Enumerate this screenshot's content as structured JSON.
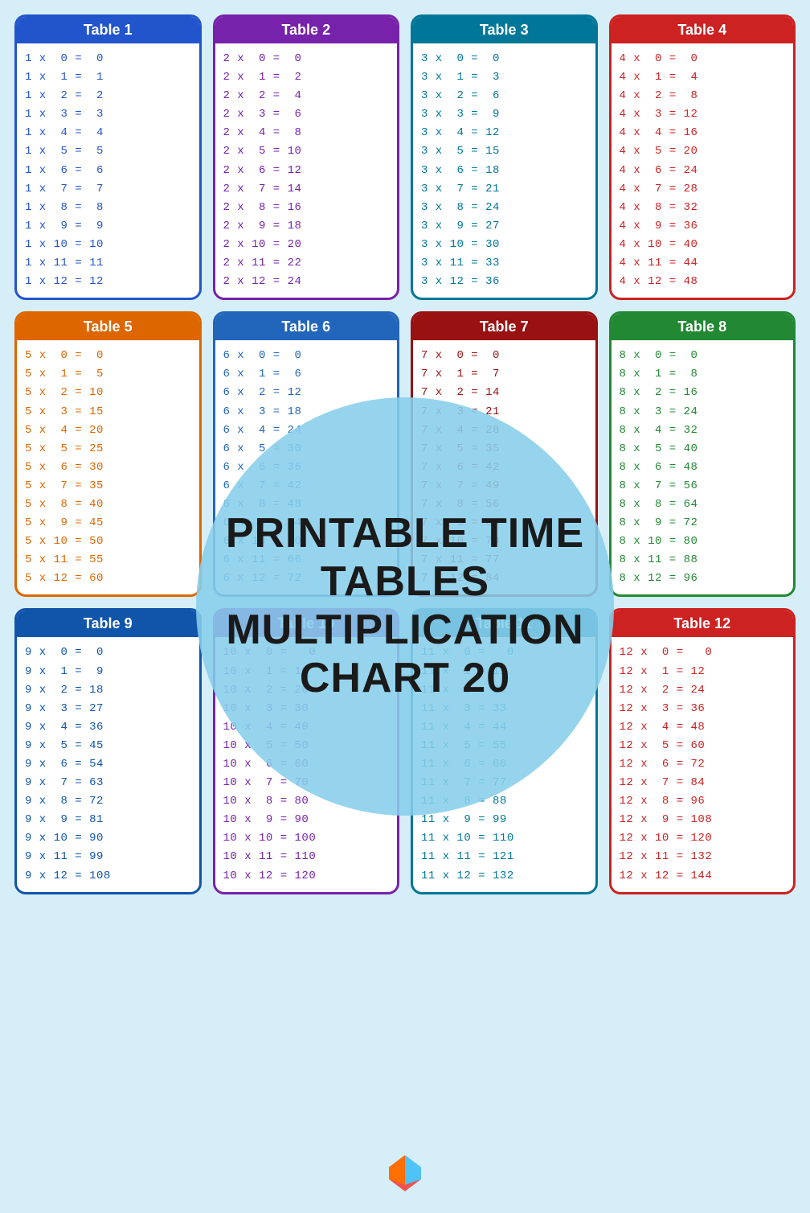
{
  "title": "PRINTABLE TIME TABLES MULTIPLICATION CHART 20",
  "background_color": "#d6eef8",
  "circle_color": "rgba(135,206,235,0.88)",
  "tables": [
    {
      "id": 1,
      "label": "Table 1",
      "color": "blue",
      "rows": [
        "1 x  0  =  0",
        "1 x  1  =  1",
        "1 x  2  =  2",
        "1 x  3  =  3",
        "1 x  4  =  4",
        "1 x  5  =  5",
        "1 x  6  =  6",
        "1 x  7  =  7",
        "1 x  8  =  8",
        "1 x  9  =  9",
        "1 x 10  = 10",
        "1 x 11  = 11",
        "1 x 12  = 12"
      ]
    },
    {
      "id": 2,
      "label": "Table 2",
      "color": "purple",
      "rows": [
        "2 x  0  =  0",
        "2 x  1  =  2",
        "2 x  2  =  4",
        "2 x  3  =  6",
        "2 x  4  =  8",
        "2 x  5  = 10",
        "2 x  6  = 12",
        "2 x  7  = 14",
        "2 x  8  = 16",
        "2 x  9  = 18",
        "2 x 10  = 20",
        "2 x 11  = 22",
        "2 x 12  = 24"
      ]
    },
    {
      "id": 3,
      "label": "Table 3",
      "color": "teal",
      "rows": [
        "3 x  0  =  0",
        "3 x  1  =  3",
        "3 x  2  =  6",
        "3 x  3  =  9",
        "3 x  4  = 12",
        "3 x  5  = 15",
        "3 x  6  = 18",
        "3 x  7  = 21",
        "3 x  8  = 24",
        "3 x  9  = 27",
        "3 x 10  = 30",
        "3 x 11  = 33",
        "3 x 12  = 36"
      ]
    },
    {
      "id": 4,
      "label": "Table 4",
      "color": "red",
      "rows": [
        "4 x  0  =  0",
        "4 x  1  =  4",
        "4 x  2  =  8",
        "4 x  3  = 12",
        "4 x  4  = 16",
        "4 x  5  = 20",
        "4 x  6  = 24",
        "4 x  7  = 28",
        "4 x  8  = 32",
        "4 x  9  = 36",
        "4 x 10  = 40",
        "4 x 11  = 44",
        "4 x 12  = 48"
      ]
    },
    {
      "id": 5,
      "label": "Table 5",
      "color": "orange",
      "rows": [
        "5 x  0  =  0",
        "5 x  1  =  5",
        "5 x  2  = 10",
        "5 x  3  = 15",
        "5 x  4  = 20",
        "5 x  5  = 25",
        "5 x  6  = 30",
        "5 x  7  = 35",
        "5 x  8  = 40",
        "5 x  9  = 45",
        "5 x 10  = 50",
        "5 x 11  = 55",
        "5 x 12  = 60"
      ]
    },
    {
      "id": 6,
      "label": "Table 6",
      "color": "blue2",
      "rows": [
        "6 x  0  =  0",
        "6 x  1  =  6",
        "6 x  2  = 12",
        "6 x  3  = 18",
        "6 x  4  = 24",
        "6 x  5  = 30",
        "6 x  6  = 36",
        "6 x  7  = 42",
        "6 x  8  = 48",
        "6 x  9  = 54",
        "6 x 10  = 60",
        "6 x 11  = 66",
        "6 x 12  = 72"
      ]
    },
    {
      "id": 7,
      "label": "Table 7",
      "color": "darkred",
      "rows": [
        "7 x  0  =  0",
        "7 x  1  =  7",
        "7 x  2  = 14",
        "7 x  3  = 21",
        "7 x  4  = 28",
        "7 x  5  = 35",
        "7 x  6  = 42",
        "7 x  7  = 49",
        "7 x  8  = 56",
        "7 x  9  = 63",
        "7 x 10  = 70",
        "7 x 11  = 77",
        "7 x 12  = 84"
      ]
    },
    {
      "id": 8,
      "label": "Table 8",
      "color": "green",
      "rows": [
        "8 x  0  =  0",
        "8 x  1  =  8",
        "8 x  2  = 16",
        "8 x  3  = 24",
        "8 x  4  = 32",
        "8 x  5  = 40",
        "8 x  6  = 48",
        "8 x  7  = 56",
        "8 x  8  = 64",
        "8 x  9  = 72",
        "8 x 10  = 80",
        "8 x 11  = 88",
        "8 x 12  = 96"
      ]
    },
    {
      "id": 9,
      "label": "Table 9",
      "color": "darkblue",
      "rows": [
        "9 x  0  =  0",
        "9 x  1  =  9",
        "9 x  2  = 18",
        "9 x  3  = 27",
        "9 x  4  = 36",
        "9 x  5  = 45",
        "9 x  6  = 54",
        "9 x  7  = 63",
        "9 x  8  = 72",
        "9 x  9  = 81",
        "9 x 10  = 90",
        "9 x 11  = 99",
        "9 x 12  = 108"
      ]
    },
    {
      "id": 10,
      "label": "Table 10",
      "color": "purple",
      "rows": [
        "10 x  0  =  0",
        "10 x  1  = 10",
        "10 x  2  = 20",
        "10 x  3  = 30",
        "10 x  4  = 40",
        "10 x  5  = 50",
        "10 x  6  = 60",
        "10 x  7  = 70",
        "10 x  8  = 80",
        "10 x  9  = 90",
        "10 x 10  = 100",
        "10 x 11  = 110",
        "10 x 12  = 120"
      ]
    },
    {
      "id": 11,
      "label": "Table 11",
      "color": "teal",
      "rows": [
        "11 x  0  =  0",
        "11 x  1  = 11",
        "11 x  2  = 22",
        "11 x  3  = 33",
        "11 x  4  = 44",
        "11 x  5  = 55",
        "11 x  6  = 66",
        "11 x  7  = 77",
        "11 x  8  = 88",
        "11 x  9  = 99",
        "11 x 10  = 110",
        "11 x 11  = 121",
        "11 x 12  = 132"
      ]
    },
    {
      "id": 12,
      "label": "Table 12",
      "color": "red",
      "rows": [
        "12 x  0  =  0",
        "12 x  1  = 12",
        "12 x  2  = 24",
        "12 x  3  = 36",
        "12 x  4  = 48",
        "12 x  5  = 60",
        "12 x  6  = 72",
        "12 x  7  = 84",
        "12 x  8  = 96",
        "12 x  9  = 108",
        "12 x 10  = 120",
        "12 x 11  = 132",
        "12 x 12  = 144"
      ]
    }
  ]
}
